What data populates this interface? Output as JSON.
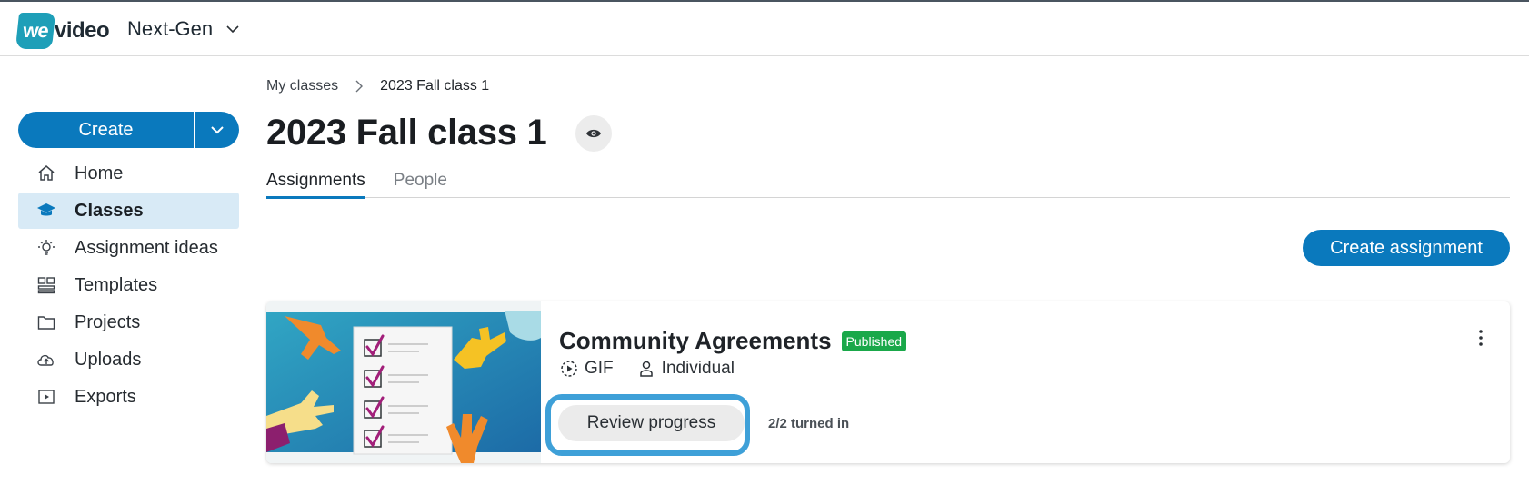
{
  "app": {
    "logo_prefix": "we",
    "logo_word": "video",
    "workspace": "Next-Gen"
  },
  "sidebar": {
    "create_label": "Create",
    "items": [
      {
        "label": "Home",
        "icon": "home-icon"
      },
      {
        "label": "Classes",
        "icon": "graduation-cap-icon",
        "active": true
      },
      {
        "label": "Assignment ideas",
        "icon": "lightbulb-icon"
      },
      {
        "label": "Templates",
        "icon": "templates-icon"
      },
      {
        "label": "Projects",
        "icon": "folder-icon"
      },
      {
        "label": "Uploads",
        "icon": "cloud-upload-icon"
      },
      {
        "label": "Exports",
        "icon": "export-play-icon"
      }
    ]
  },
  "breadcrumb": {
    "parent": "My classes",
    "current": "2023 Fall class 1"
  },
  "page": {
    "title": "2023 Fall class 1",
    "tabs": [
      "Assignments",
      "People"
    ],
    "active_tab": "Assignments",
    "create_assignment_label": "Create assignment"
  },
  "assignment": {
    "title": "Community Agreements",
    "status": "Published",
    "format": "GIF",
    "mode": "Individual",
    "review_label": "Review progress",
    "turned_in": "2/2 turned in"
  },
  "colors": {
    "primary": "#0a79bd",
    "active_nav": "#d8eaf6",
    "published": "#1aa84a",
    "highlight_ring": "#3ea0d8"
  }
}
